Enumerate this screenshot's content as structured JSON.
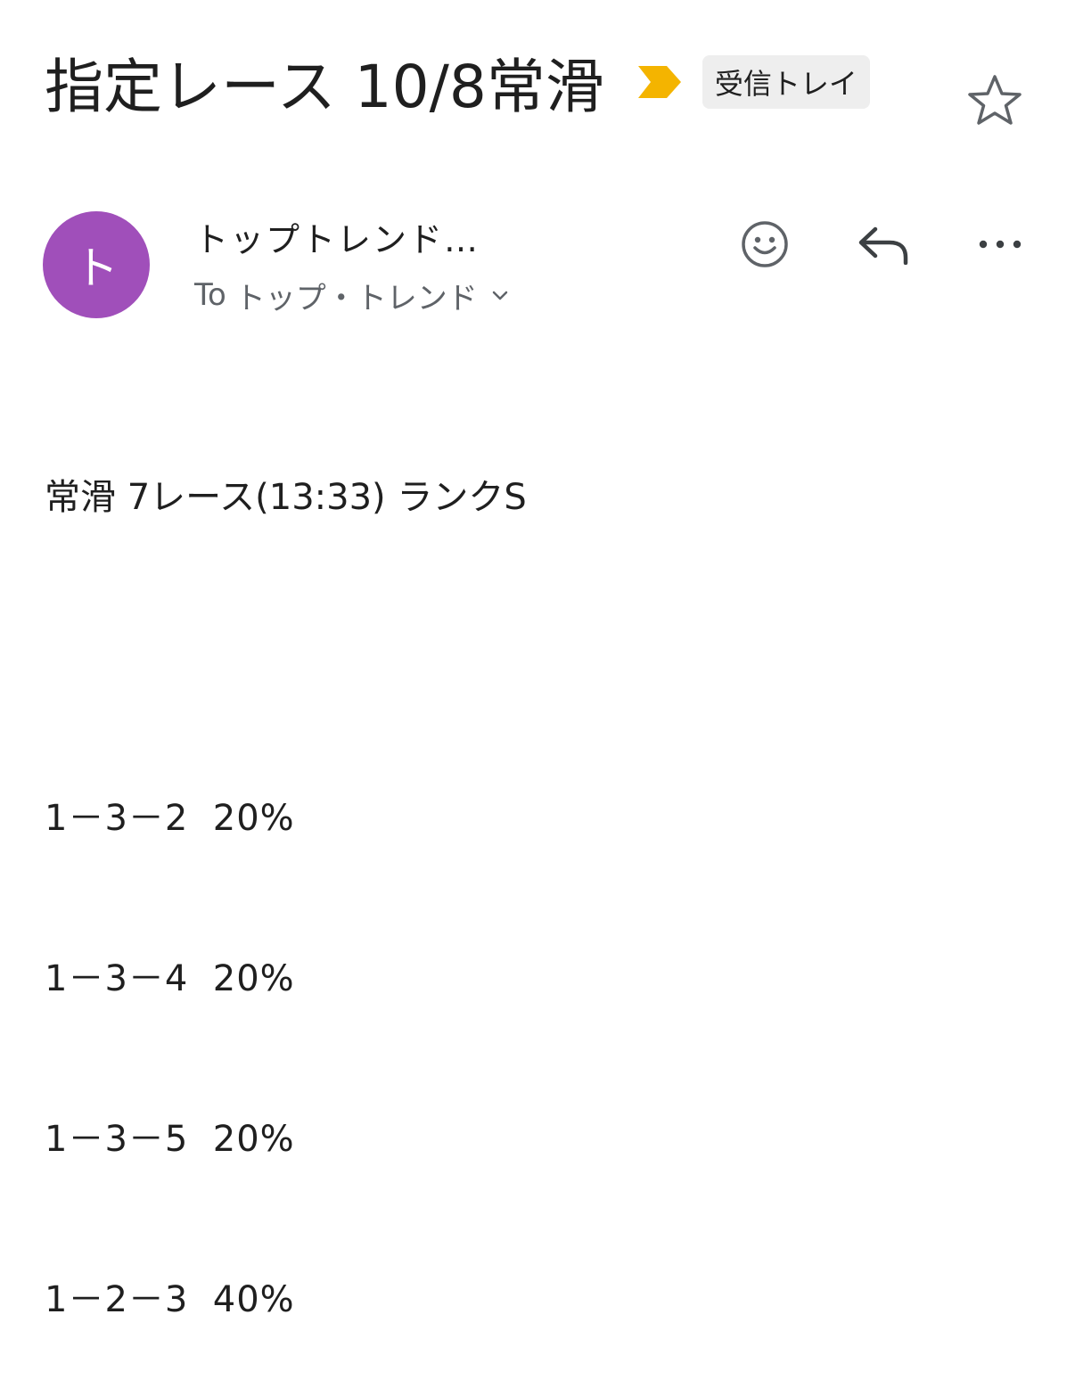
{
  "email": {
    "subject": "指定レース 10/8常滑",
    "label": "受信トレイ",
    "importance_marker_color": "#f4b400",
    "sender": {
      "avatar_letter": "ト",
      "avatar_color": "#a04fba",
      "name": "トップトレンド…",
      "recipient_prefix": "To",
      "recipient": "トップ・トレンド"
    },
    "body": {
      "headline": "常滑 7レース(13:33) ランクS",
      "bets": [
        "1－3－2  20%",
        "1－3－4  20%",
        "1－3－5  20%",
        "1－2－3  40%"
      ]
    }
  },
  "icons": {
    "star": "star-outline-icon",
    "importance": "importance-marker-icon",
    "emoji": "emoji-reaction-icon",
    "reply": "reply-icon",
    "more": "more-horizontal-icon",
    "recipient_expand": "chevron-down-icon"
  }
}
